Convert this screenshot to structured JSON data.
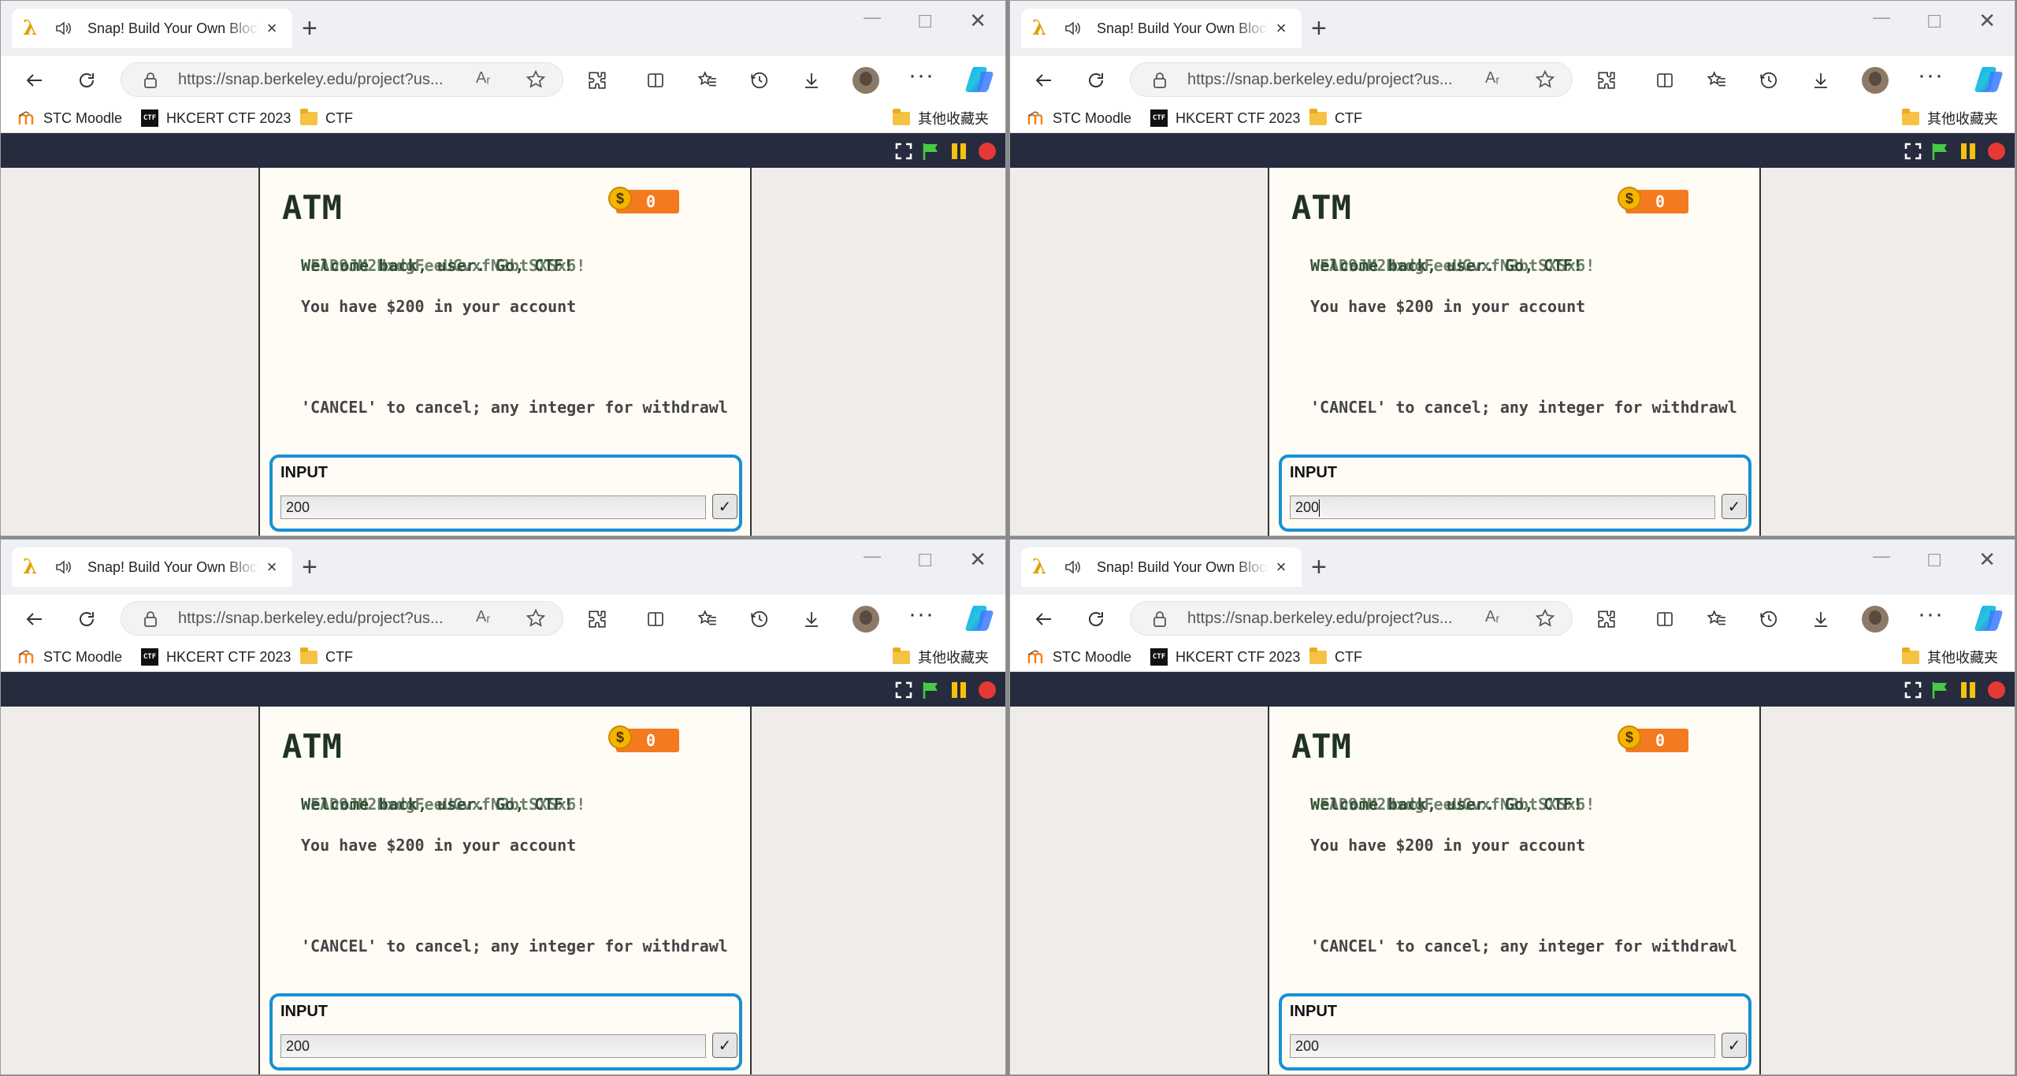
{
  "tab": {
    "title": "Snap! Build Your Own Blocks",
    "new_tab": "+",
    "close": "×"
  },
  "window_controls": {
    "minimize": "—",
    "maximize": "☐",
    "close": "✕"
  },
  "toolbar": {
    "url": "https://snap.berkeley.edu/project?us...",
    "read_aloud": "Aᵣ",
    "more": "···"
  },
  "bookmarks": [
    {
      "label": "STC Moodle",
      "icon": "moodle-icon"
    },
    {
      "label": "HKCERT CTF 2023",
      "icon": "ctf-logo-icon",
      "badge": "CTF"
    },
    {
      "label": "CTF",
      "icon": "folder-icon"
    }
  ],
  "other_favorites": "其他收藏夹",
  "stage": {
    "title": "ATM",
    "coins": "0",
    "coin_symbol": "$",
    "welcome_a": "Welcome back, user. Go, CTF!  ",
    "welcome_b": "WFAD9JM2HxdgFeeUGvxfN2btSXSx6!",
    "balance": "You have $200 in your account",
    "prompt": "'CANCEL' to cancel; any integer for withdrawl",
    "input_label": "INPUT",
    "input_value": "200",
    "submit": "✓"
  },
  "colors": {
    "accent": "#1a8fd6",
    "snap_bar": "#262b3e",
    "coin_box": "#f47a20",
    "flag": "#47c945",
    "pause": "#f4c20d",
    "stop": "#e53935"
  }
}
